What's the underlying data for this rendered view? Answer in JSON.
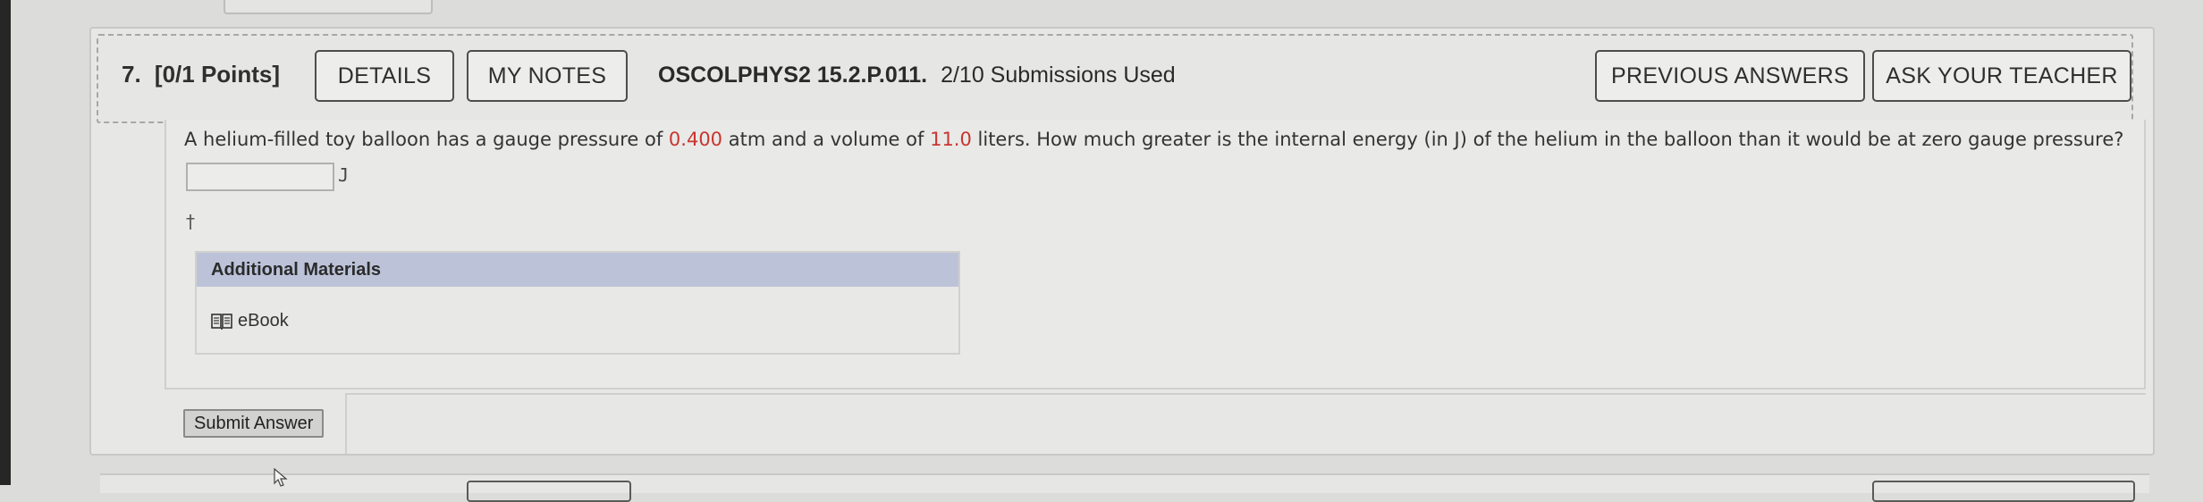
{
  "question": {
    "number_label": "7.",
    "points_label": "[0/1 Points]",
    "details_label": "DETAILS",
    "my_notes_label": "MY NOTES",
    "code": "OSCOLPHYS2 15.2.P.011.",
    "submissions": "2/10 Submissions Used",
    "previous_answers_label": "PREVIOUS ANSWERS",
    "ask_teacher_label": "ASK YOUR TEACHER",
    "text_part1": "A helium-filled toy balloon has a gauge pressure of ",
    "pressure_value": "0.400",
    "text_part2": " atm and a volume of ",
    "volume_value": "11.0",
    "text_part3": " liters. How much greater is the internal energy (in J) of the helium in the balloon than it would be at zero gauge pressure?",
    "answer_value": "",
    "answer_unit": "J",
    "dagger": "†"
  },
  "materials": {
    "title": "Additional Materials",
    "ebook_label": "eBook",
    "ebook_icon": "book-icon"
  },
  "actions": {
    "submit_label": "Submit Answer"
  },
  "colors": {
    "accent_red": "#c8352f",
    "materials_header": "#bcc3d9"
  }
}
